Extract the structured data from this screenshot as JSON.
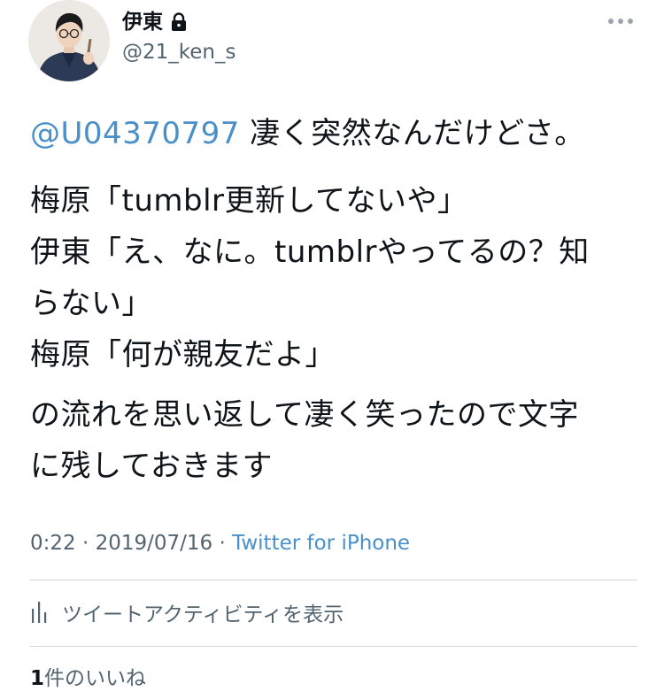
{
  "author": {
    "display_name": "伊東",
    "handle": "@21_ken_s",
    "avatar_icon": "profile-photo",
    "verified_lock_icon": "lock-icon"
  },
  "tweet": {
    "mention": "@U04370797",
    "line1_rest": " 凄く突然なんだけどさ。",
    "lines": [
      "梅原「tumblr更新してないや」",
      "伊東「え、なに。tumblrやってるの？知",
      "らない」",
      "梅原「何が親友だよ」"
    ],
    "closing_lines": [
      "の流れを思い返して凄く笑ったので文字",
      "に残しておきます"
    ]
  },
  "meta": {
    "time": "0:22",
    "separator1": " · ",
    "date": "2019/07/16",
    "separator2": " · ",
    "source": "Twitter for iPhone"
  },
  "actions": {
    "activity_label": "ツイートアクティビティを表示",
    "activity_icon": "bar-chart-icon"
  },
  "likes": {
    "count": "1",
    "label": "件のいいね"
  },
  "colors": {
    "link": "#4a90c8",
    "text": "#0f1419",
    "muted": "#536471",
    "divider": "#d6d9dc"
  }
}
